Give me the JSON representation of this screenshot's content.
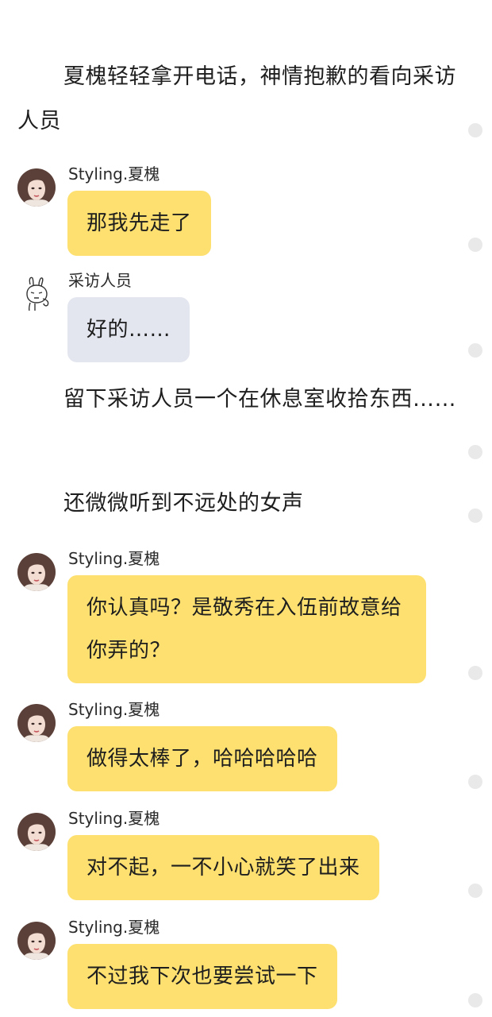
{
  "story": {
    "narration_1": "夏槐轻轻拿开电话，神情抱歉的看向采访人员",
    "narration_2": "留下采访人员一个在休息室收拾东西……",
    "narration_3": "还微微听到不远处的女声"
  },
  "speakers": {
    "xiahuai": "Styling.夏槐",
    "reporter": "采访人员"
  },
  "messages": [
    {
      "speaker": "Styling.夏槐",
      "text": "那我先走了"
    },
    {
      "speaker": "采访人员",
      "text": "好的……"
    },
    {
      "speaker": "Styling.夏槐",
      "text": "你认真吗？是敬秀在入伍前故意给你弄的？"
    },
    {
      "speaker": "Styling.夏槐",
      "text": "做得太棒了，哈哈哈哈哈"
    },
    {
      "speaker": "Styling.夏槐",
      "text": "对不起，一不小心就笑了出来"
    },
    {
      "speaker": "Styling.夏槐",
      "text": "不过我下次也要尝试一下"
    }
  ],
  "icons": {
    "avatar_xiahuai": "woman-portrait-avatar",
    "avatar_reporter": "rabbit-sketch-avatar",
    "paragraph_marker": "comment-dot"
  },
  "colors": {
    "bubble_main": "#fde070",
    "bubble_other": "#e3e6ef",
    "text": "#1e1e1e",
    "dot": "#e9e9e9"
  }
}
